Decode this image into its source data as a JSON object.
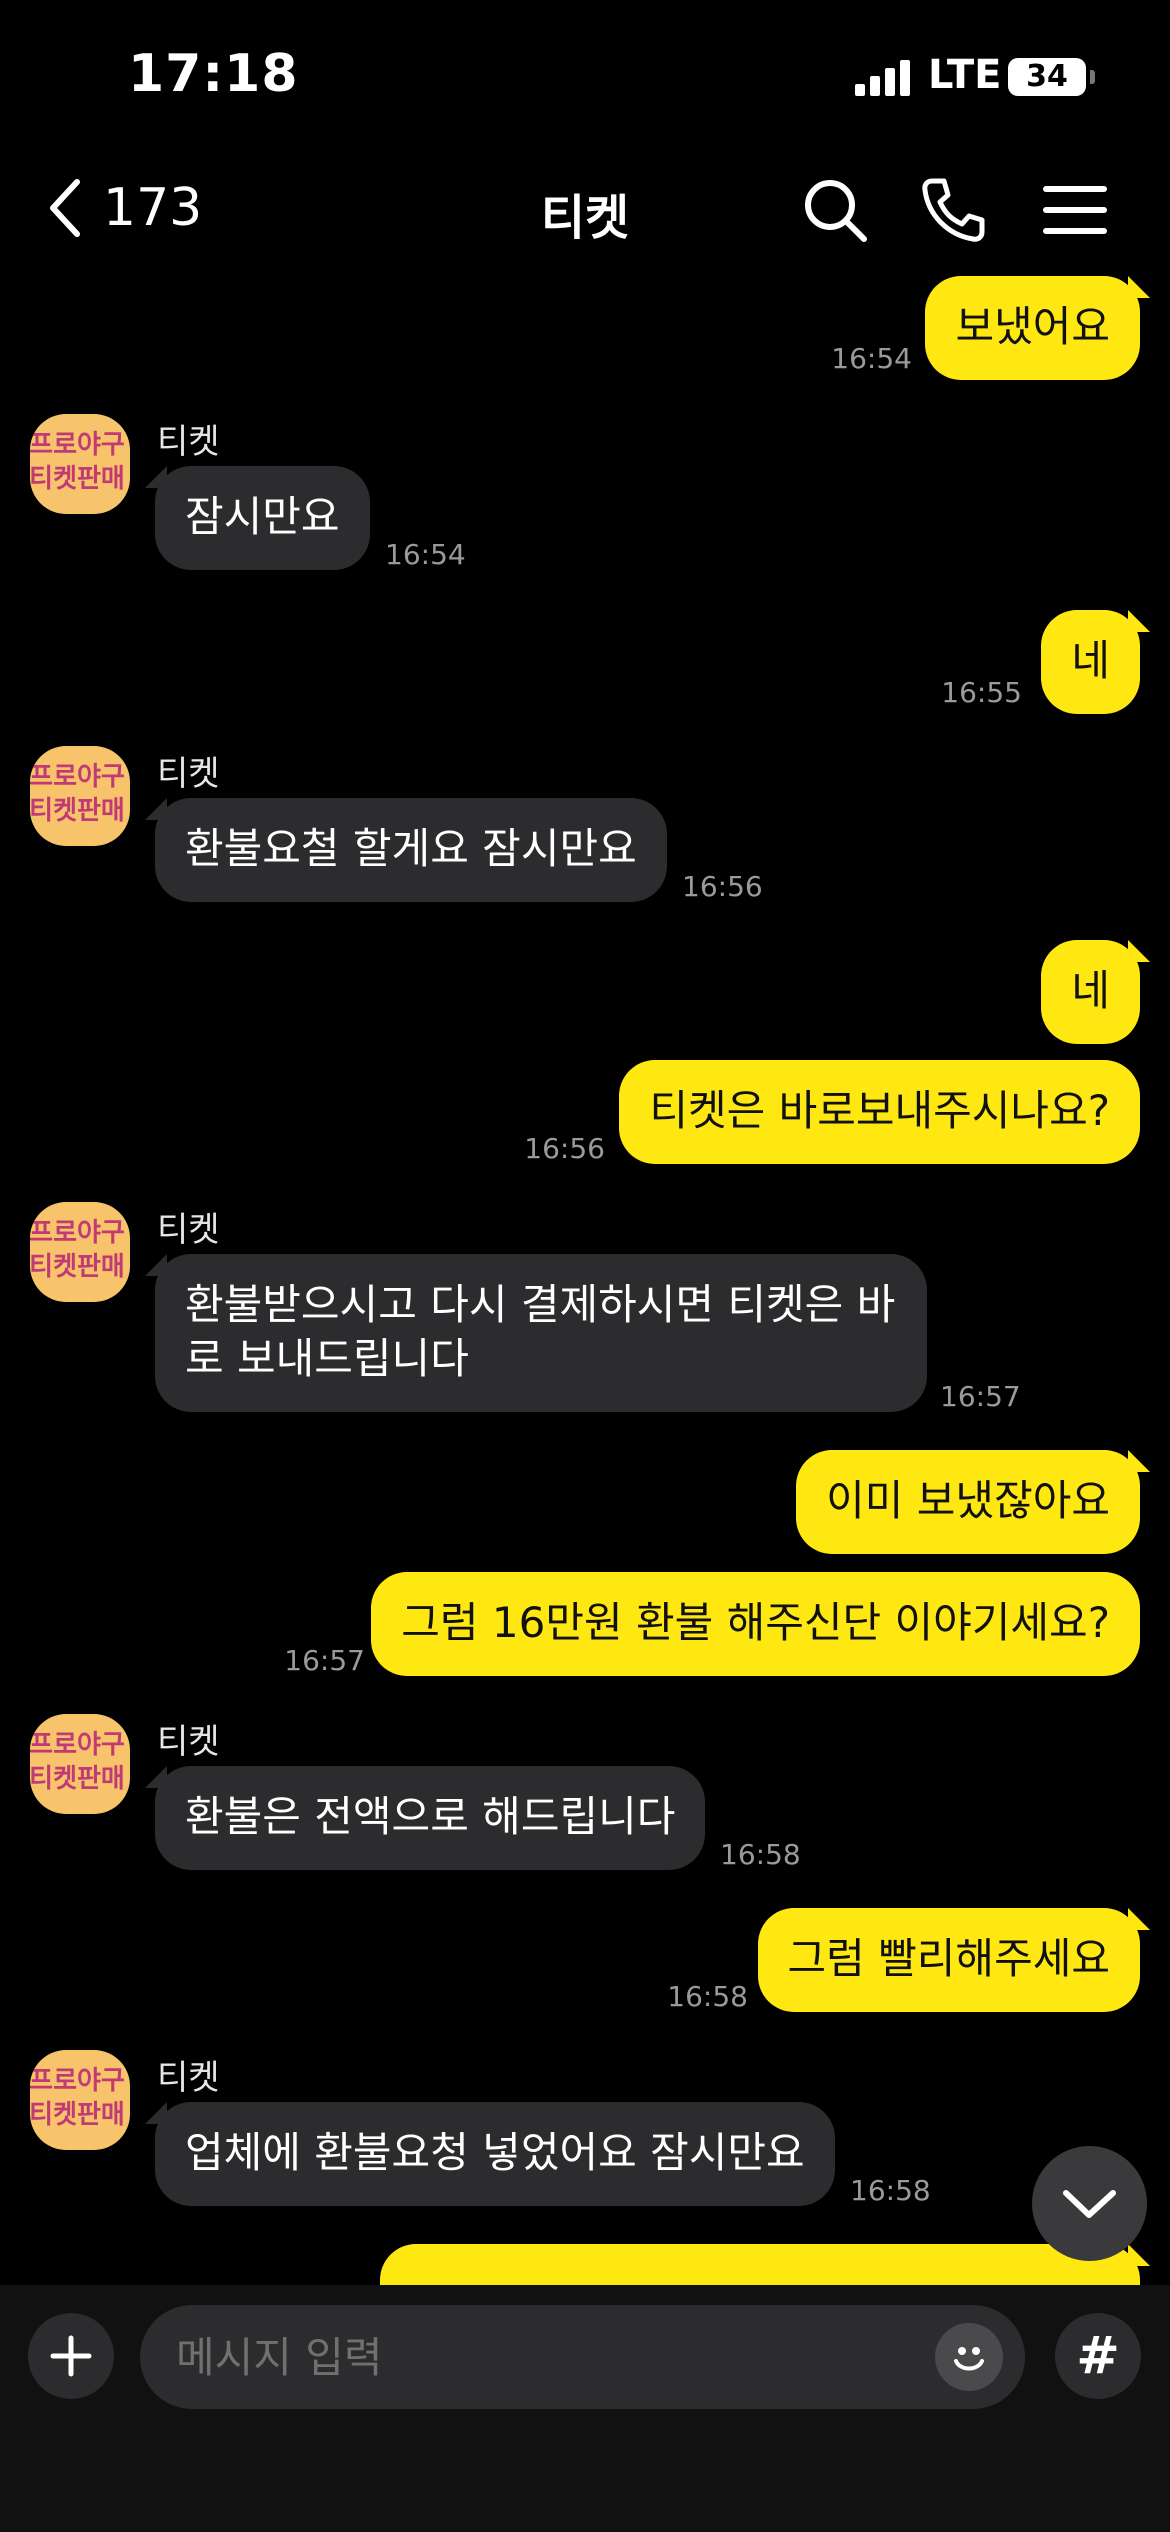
{
  "status_bar": {
    "time": "17:18",
    "network": "LTE",
    "battery": "34"
  },
  "header": {
    "unread_count": "173",
    "title": "티켓"
  },
  "icons": {
    "back": "chevron-left-icon",
    "search": "search-icon",
    "call": "phone-icon",
    "menu": "menu-icon",
    "scroll_down": "chevron-down-icon",
    "attach": "plus-icon",
    "emoji": "emoji-icon",
    "hashtag": "hashtag-icon"
  },
  "colors": {
    "outgoing_bubble": "#FFE812",
    "incoming_bubble": "#2c2c2e",
    "background": "#000000"
  },
  "messages": [
    {
      "side": "out",
      "text": "보냈어요",
      "time": "16:54"
    },
    {
      "side": "in",
      "sender": "티켓",
      "text": "잠시만요",
      "time": "16:54"
    },
    {
      "side": "out",
      "text": "네",
      "time": "16:55"
    },
    {
      "side": "in",
      "sender": "티켓",
      "text": "환불요철 할게요 잠시만요",
      "time": "16:56"
    },
    {
      "side": "out",
      "text": "네"
    },
    {
      "side": "out",
      "text": "티켓은 바로보내주시나요?",
      "time": "16:56"
    },
    {
      "side": "in",
      "sender": "티켓",
      "text_line1": "환불받으시고 다시 결제하시면 티켓은 바",
      "text_line2": "로 보내드립니다",
      "time": "16:57"
    },
    {
      "side": "out",
      "text": "이미 보냈잖아요"
    },
    {
      "side": "out",
      "text": "그럼 16만원 환불 해주신단 이야기세요?",
      "time": "16:57"
    },
    {
      "side": "in",
      "sender": "티켓",
      "text": "환불은 전액으로 해드립니다",
      "time": "16:58"
    },
    {
      "side": "out",
      "text": "그럼 빨리해주세요",
      "time": "16:58"
    },
    {
      "side": "in",
      "sender": "티켓",
      "text": "업체에 환불요청 넣었어요 잠시만요",
      "time": "16:58"
    }
  ],
  "avatar": {
    "line1": "프로야구",
    "line2": "티켓판매"
  },
  "composer": {
    "placeholder": "메시지 입력",
    "hash_label": "#"
  }
}
